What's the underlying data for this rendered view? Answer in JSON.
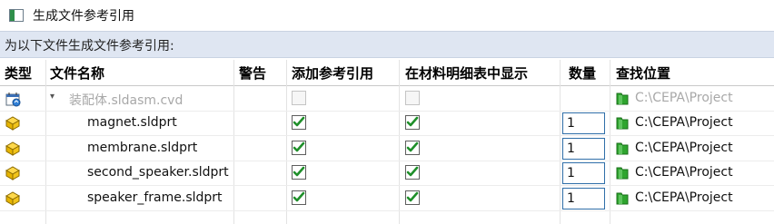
{
  "window": {
    "title": "生成文件参考引用"
  },
  "prompt": "为以下文件生成文件参考引用:",
  "columns": {
    "type": "类型",
    "filename": "文件名称",
    "warning": "警告",
    "add_reference": "添加参考引用",
    "show_in_bom": "在材料明细表中显示",
    "quantity": "数量",
    "find_location": "查找位置"
  },
  "rows": [
    {
      "icon": "assembly-icon",
      "name": "装配体.sldasm.cvd",
      "disabled": true,
      "add_reference": false,
      "show_in_bom": false,
      "quantity": "",
      "location": "C:\\CEPA\\Project"
    },
    {
      "icon": "part-icon",
      "name": "magnet.sldprt",
      "disabled": false,
      "add_reference": true,
      "show_in_bom": true,
      "quantity": "1",
      "location": "C:\\CEPA\\Project"
    },
    {
      "icon": "part-icon",
      "name": "membrane.sldprt",
      "disabled": false,
      "add_reference": true,
      "show_in_bom": true,
      "quantity": "1",
      "location": "C:\\CEPA\\Project"
    },
    {
      "icon": "part-icon",
      "name": "second_speaker.sldprt",
      "disabled": false,
      "add_reference": true,
      "show_in_bom": true,
      "quantity": "1",
      "location": "C:\\CEPA\\Project"
    },
    {
      "icon": "part-icon",
      "name": "speaker_frame.sldprt",
      "disabled": false,
      "add_reference": true,
      "show_in_bom": true,
      "quantity": "1",
      "location": "C:\\CEPA\\Project"
    }
  ],
  "colors": {
    "check_green": "#1f8f2a",
    "folder_green": "#2fa52f",
    "prompt_bg": "#dfe6f2"
  }
}
